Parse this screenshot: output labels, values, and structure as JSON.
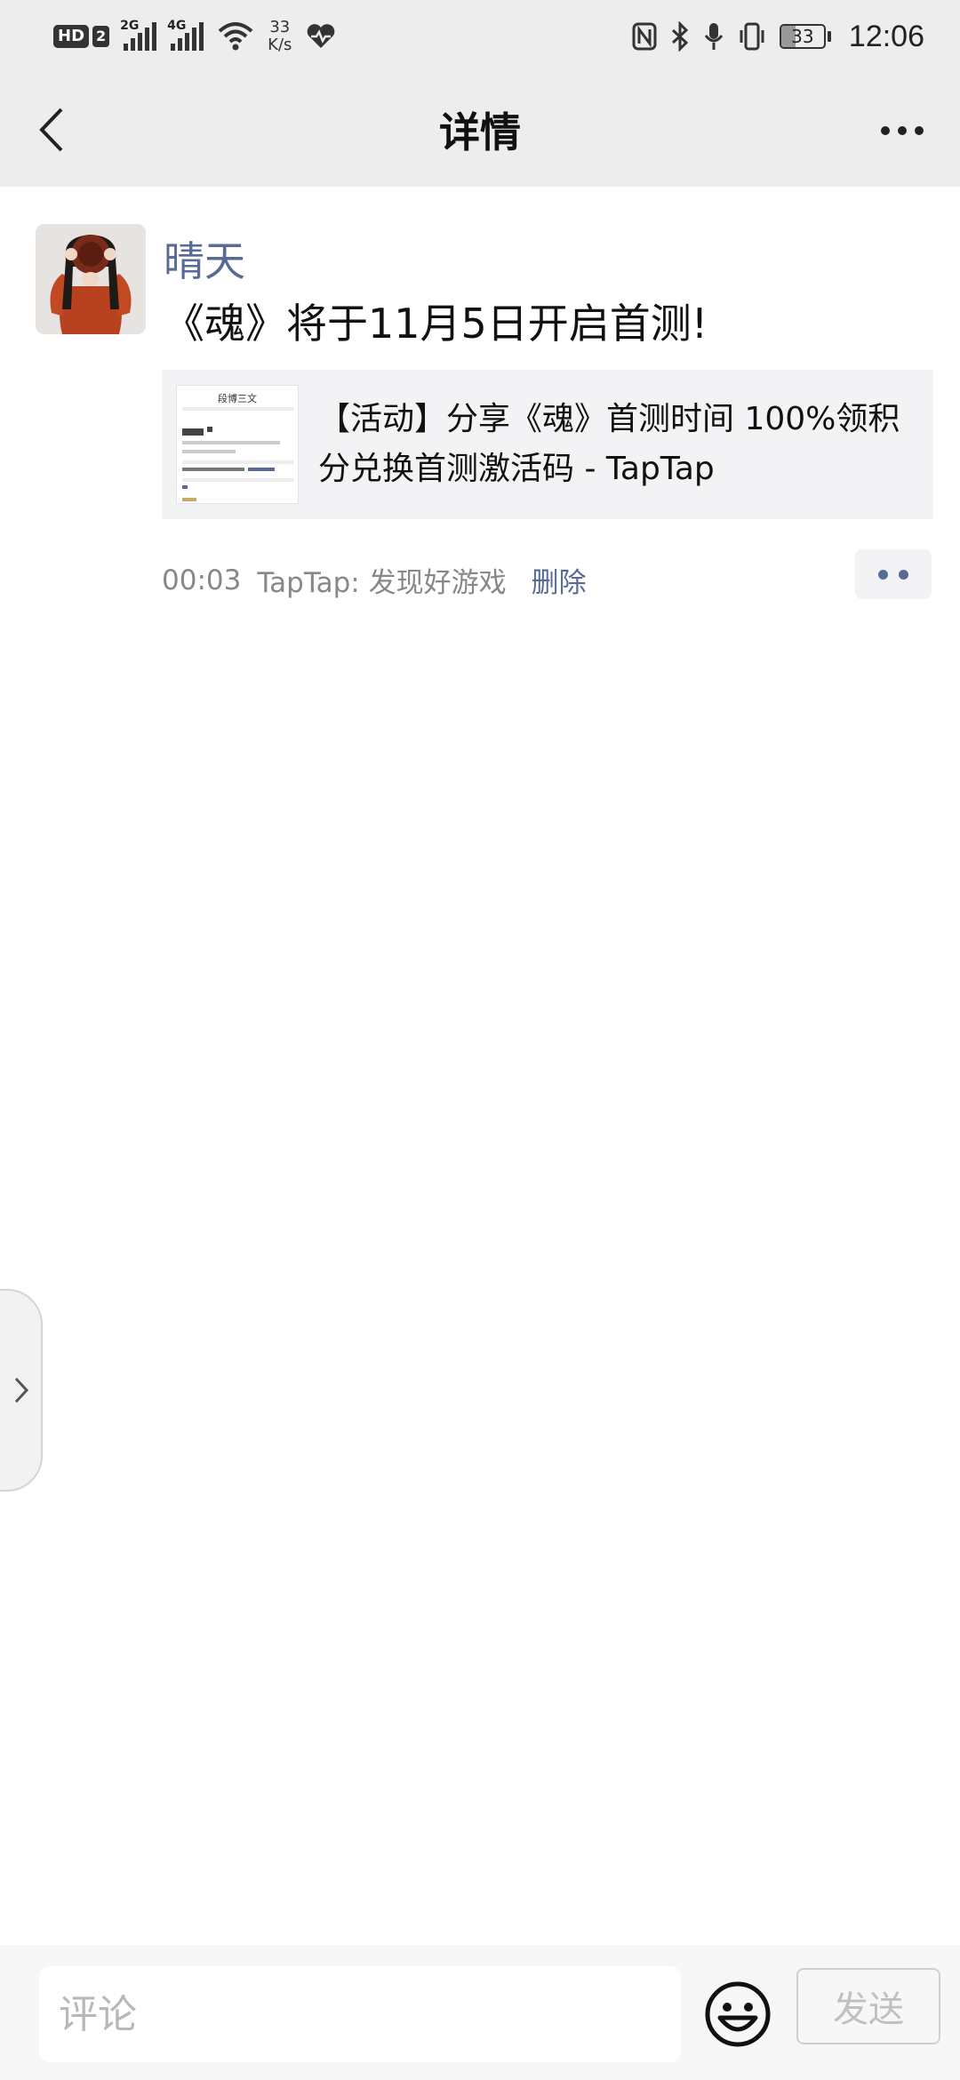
{
  "status_bar": {
    "hd_label": "HD",
    "hd_sim": "2",
    "signal_1_label": "2G",
    "signal_2_label": "4G",
    "speed_value": "33",
    "speed_unit": "K/s",
    "battery_level": "33",
    "battery_fraction": 0.33,
    "time": "12:06"
  },
  "nav": {
    "title": "详情"
  },
  "post": {
    "author": "晴天",
    "text": "《魂》将于11月5日开启首测!",
    "link_card": {
      "title": "【活动】分享《魂》首测时间 100%领积分兑换首测激活码 - TapTap",
      "thumbnail_title": "段博三文"
    },
    "meta": {
      "time": "00:03",
      "source": "TapTap: 发现好游戏",
      "delete_label": "删除"
    }
  },
  "comment_bar": {
    "placeholder": "评论",
    "send_label": "发送"
  },
  "colors": {
    "link_blue": "#576b95",
    "header_bg": "#ededed"
  },
  "icons": {
    "back": "chevron-left-icon",
    "more": "more-dots-icon",
    "emoji": "smiley-icon",
    "side_handle": "chevron-right-icon"
  }
}
